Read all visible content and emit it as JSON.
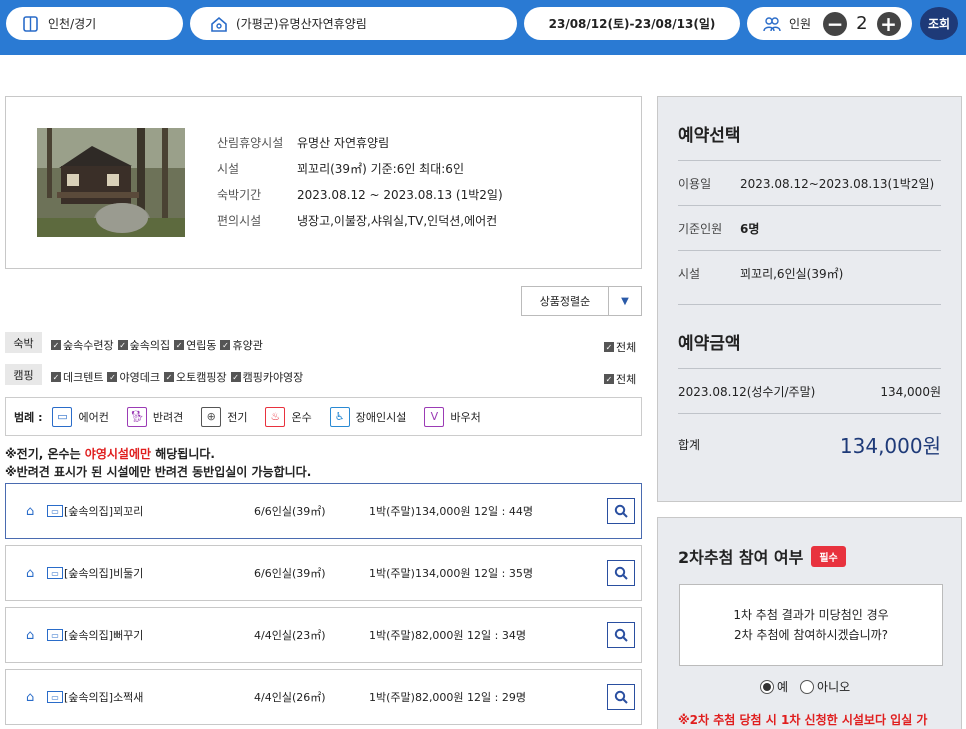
{
  "topbar": {
    "region": "인천/경기",
    "place": "(가평군)유명산자연휴양림",
    "dates": "23/08/12(토)-23/08/13(일)",
    "people_label": "인원",
    "people_count": "2",
    "search_label": "조회"
  },
  "info": {
    "rows": [
      {
        "k": "산림휴양시설",
        "v": "유명산 자연휴양림"
      },
      {
        "k": "시설",
        "v": "꾀꼬리(39㎡) 기준:6인 최대:6인"
      },
      {
        "k": "숙박기간",
        "v": "2023.08.12 ~ 2023.08.13 (1박2일)"
      },
      {
        "k": "편의시설",
        "v": "냉장고,이불장,샤워실,TV,인덕션,에어컨"
      }
    ]
  },
  "sort": {
    "label": "상품정렬순"
  },
  "filters": {
    "stay": {
      "tag": "숙박",
      "items": [
        "숲속수련장",
        "숲속의집",
        "연립동",
        "휴양관"
      ],
      "all": "전체"
    },
    "camp": {
      "tag": "캠핑",
      "items": [
        "데크텐트",
        "야영데크",
        "오토캠핑장",
        "캠핑카야영장"
      ],
      "all": "전체"
    }
  },
  "legend": {
    "title": "범례 :",
    "items": [
      "에어컨",
      "반려견",
      "전기",
      "온수",
      "장애인시설",
      "바우처"
    ]
  },
  "notes": {
    "line1_a": "※전기, 온수는 ",
    "line1_b": "야영시설에만",
    "line1_c": " 해당됩니다.",
    "line2": "※반려견 표시가 된 시설에만 반려견 동반입실이 가능합니다."
  },
  "rooms": [
    {
      "name": "[숲속의집]꾀꼬리",
      "room": "6/6인실(39㎡)",
      "price": "1박(주말)134,000원   12일 : 44명"
    },
    {
      "name": "[숲속의집]비둘기",
      "room": "6/6인실(39㎡)",
      "price": "1박(주말)134,000원   12일 : 35명"
    },
    {
      "name": "[숲속의집]뻐꾸기",
      "room": "4/4인실(23㎡)",
      "price": "1박(주말)82,000원   12일 : 34명"
    },
    {
      "name": "[숲속의집]소쩍새",
      "room": "4/4인실(26㎡)",
      "price": "1박(주말)82,000원   12일 : 29명"
    }
  ],
  "side": {
    "title": "예약선택",
    "use_k": "이용일",
    "use_v": "2023.08.12~2023.08.13(1박2일)",
    "base_k": "기준인원",
    "base_v": "6명",
    "fac_k": "시설",
    "fac_v": "꾀꼬리,6인실(39㎡)",
    "amount_title": "예약금액",
    "amount_row_k": "2023.08.12(성수기/주말)",
    "amount_row_v": "134,000원",
    "total_k": "합계",
    "total_v": "134,000원"
  },
  "lottery": {
    "title": "2차추첨 참여 여부",
    "badge": "필수",
    "q1": "1차 추첨 결과가 미당첨인 경우",
    "q2": "2차 추첨에 참여하시겠습니까?",
    "yes": "예",
    "no": "아니오",
    "warn": "※2차 추첨 당첨 시 1차 신청한 시설보다 입실 가"
  },
  "colors": {
    "bar": "#2a7ad3",
    "navy": "#1e3a78",
    "red": "#e01e1e"
  }
}
